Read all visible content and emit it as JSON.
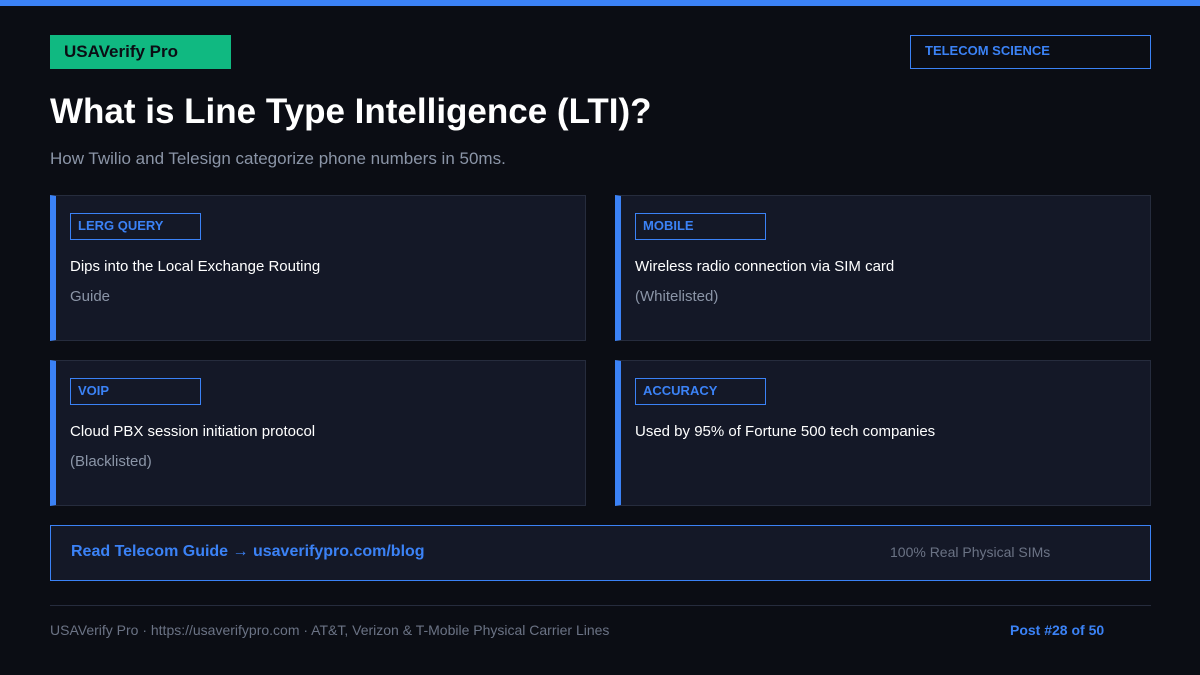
{
  "brand": {
    "icon": "",
    "name": "USAVerify Pro"
  },
  "tag": "TELECOM SCIENCE",
  "title": "What is Line Type Intelligence (LTI)?",
  "subtitle": "How Twilio and Telesign categorize phone numbers in 50ms.",
  "cards": [
    {
      "label": "LERG QUERY",
      "line1": "Dips into the Local Exchange Routing",
      "line2": "Guide"
    },
    {
      "label": "MOBILE",
      "line1": "Wireless radio connection via SIM card",
      "line2": "(Whitelisted)"
    },
    {
      "label": "VOIP",
      "line1": "Cloud PBX session initiation protocol",
      "line2": "(Blacklisted)"
    },
    {
      "label": "ACCURACY",
      "line1": "Used by 95% of Fortune 500 tech companies",
      "line2": ""
    }
  ],
  "cta": {
    "icon": "",
    "link_text": "Read Telecom Guide → usaverifypro.com/blog",
    "note": "100% Real Physical SIMs"
  },
  "footer": {
    "left": "USAVerify Pro · https://usaverifypro.com · AT&T, Verizon & T-Mobile Physical Carrier Lines",
    "right": "Post #28 of 50"
  },
  "colors": {
    "accent": "#3b82f6",
    "brand": "#10b981",
    "background": "#0b0d14",
    "card": "#141827"
  }
}
